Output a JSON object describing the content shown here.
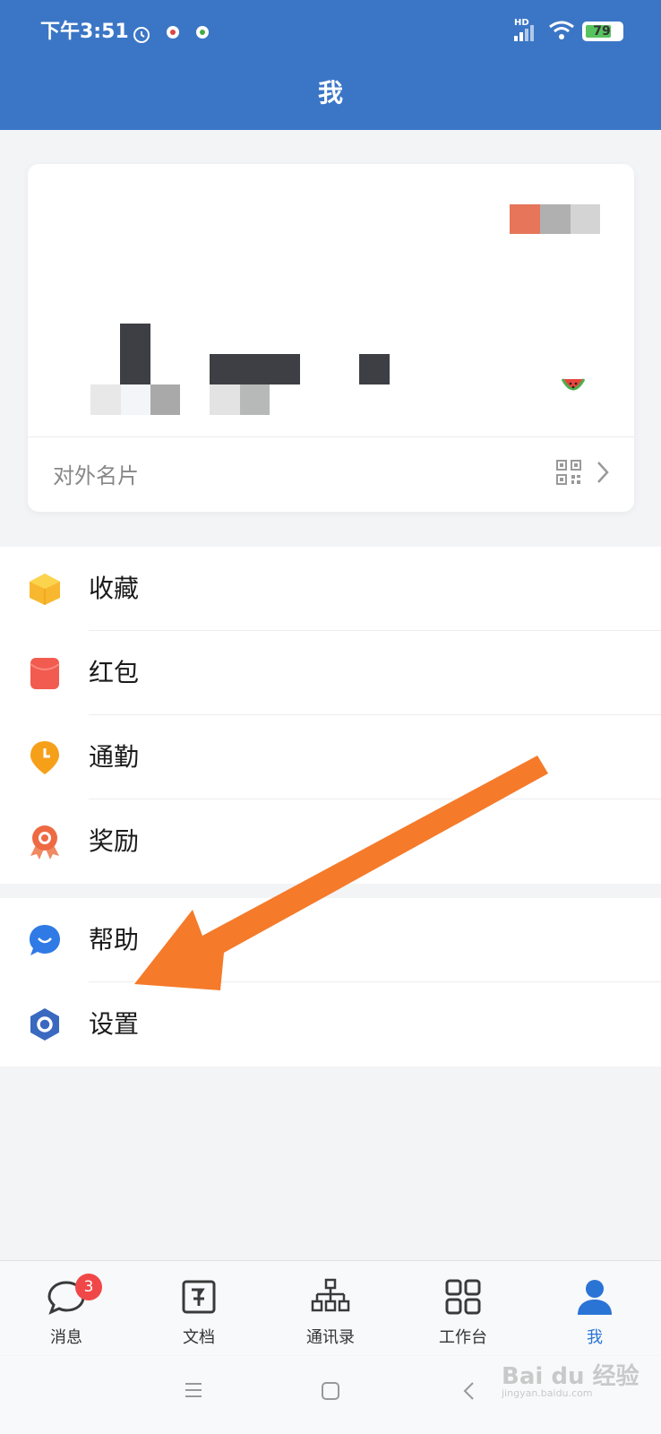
{
  "status_bar": {
    "time": "下午3:51",
    "network": "HD",
    "battery": "79"
  },
  "header": {
    "title": "我"
  },
  "profile_card": {
    "external_card_label": "对外名片"
  },
  "menu_group_1": [
    {
      "label": "收藏",
      "icon": "star-box-icon",
      "color": "#f7b82f"
    },
    {
      "label": "红包",
      "icon": "red-envelope-icon",
      "color": "#f25b4f"
    },
    {
      "label": "通勤",
      "icon": "commute-pin-icon",
      "color": "#f6a01a"
    },
    {
      "label": "奖励",
      "icon": "award-medal-icon",
      "color": "#ee6a43"
    }
  ],
  "menu_group_2": [
    {
      "label": "帮助",
      "icon": "help-chat-icon",
      "color": "#2f7ae5"
    },
    {
      "label": "设置",
      "icon": "settings-hex-icon",
      "color": "#3a69c0"
    }
  ],
  "tabbar": {
    "tabs": [
      {
        "label": "消息",
        "icon": "message-icon",
        "badge": "3"
      },
      {
        "label": "文档",
        "icon": "document-icon"
      },
      {
        "label": "通讯录",
        "icon": "contacts-icon"
      },
      {
        "label": "工作台",
        "icon": "workbench-grid-icon"
      },
      {
        "label": "我",
        "icon": "profile-person-icon",
        "active": true
      }
    ]
  },
  "colors": {
    "header_bg": "#3b76c6",
    "active_tab": "#2a74d6",
    "annotation_arrow": "#f57a2a"
  },
  "watermark": {
    "brand": "Bai du 经验",
    "url": "jingyan.baidu.com"
  }
}
